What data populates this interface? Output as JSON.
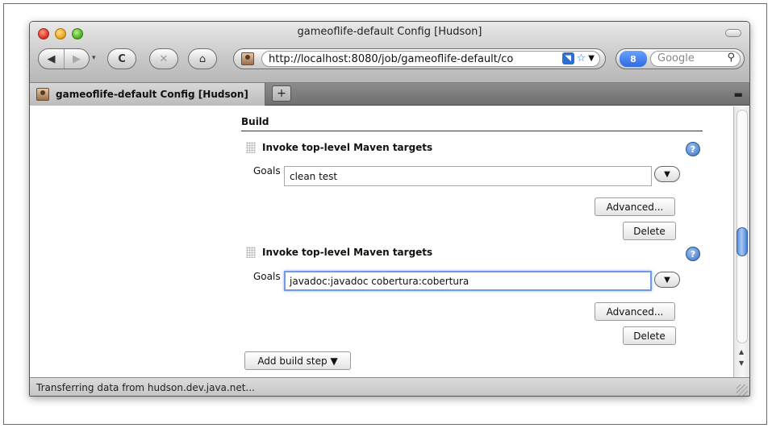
{
  "window": {
    "title": "gameoflife-default Config [Hudson]"
  },
  "toolbar": {
    "back_icon": "◀",
    "forward_icon": "▶",
    "reload_icon": "C",
    "stop_icon": "✕",
    "home_icon": "⌂",
    "url": "http://localhost:8080/job/gameoflife-default/co",
    "search_placeholder": "Google",
    "search_engine_label": "8"
  },
  "tabs": {
    "active_label": "gameoflife-default Config [Hudson]",
    "new_tab_label": "+"
  },
  "content": {
    "section_title": "Build",
    "steps": [
      {
        "title": "Invoke top-level Maven targets",
        "goals_label": "Goals",
        "goals_value": "clean test",
        "advanced_label": "Advanced...",
        "delete_label": "Delete"
      },
      {
        "title": "Invoke top-level Maven targets",
        "goals_label": "Goals",
        "goals_value": "javadoc:javadoc cobertura:cobertura",
        "advanced_label": "Advanced...",
        "delete_label": "Delete"
      }
    ],
    "add_step_label": "Add build step ▼",
    "help_glyph": "?"
  },
  "status": {
    "text": "Transferring data from hudson.dev.java.net..."
  },
  "colors": {
    "focus_ring": "#6e9be6",
    "scroll_thumb": "#5f8fdd",
    "help_blue": "#3d72c4"
  }
}
